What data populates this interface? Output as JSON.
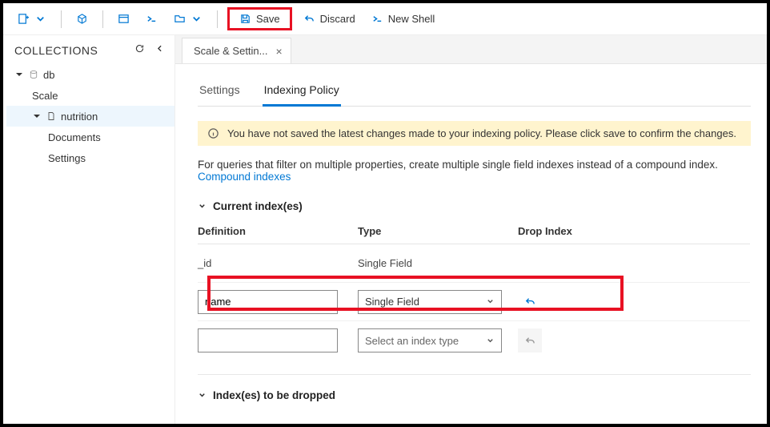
{
  "toolbar": {
    "save": "Save",
    "discard": "Discard",
    "newShell": "New Shell"
  },
  "sidebar": {
    "title": "COLLECTIONS",
    "db": "db",
    "scale": "Scale",
    "nutrition": "nutrition",
    "documents": "Documents",
    "settings": "Settings"
  },
  "tab": {
    "label": "Scale & Settin..."
  },
  "subtabs": {
    "settings": "Settings",
    "indexing": "Indexing Policy"
  },
  "banner": {
    "text": "You have not saved the latest changes made to your indexing policy. Please click save to confirm the changes."
  },
  "help": {
    "prefix": "For queries that filter on multiple properties, create multiple single field indexes instead of a compound index. ",
    "link": "Compound indexes"
  },
  "section1": "Current index(es)",
  "section2": "Index(es) to be dropped",
  "table": {
    "headers": {
      "def": "Definition",
      "type": "Type",
      "drop": "Drop Index"
    },
    "row0": {
      "def": "_id",
      "type": "Single Field"
    },
    "row1": {
      "def": "name",
      "type": "Single Field"
    },
    "row2": {
      "def": "",
      "type": "Select an index type"
    }
  }
}
